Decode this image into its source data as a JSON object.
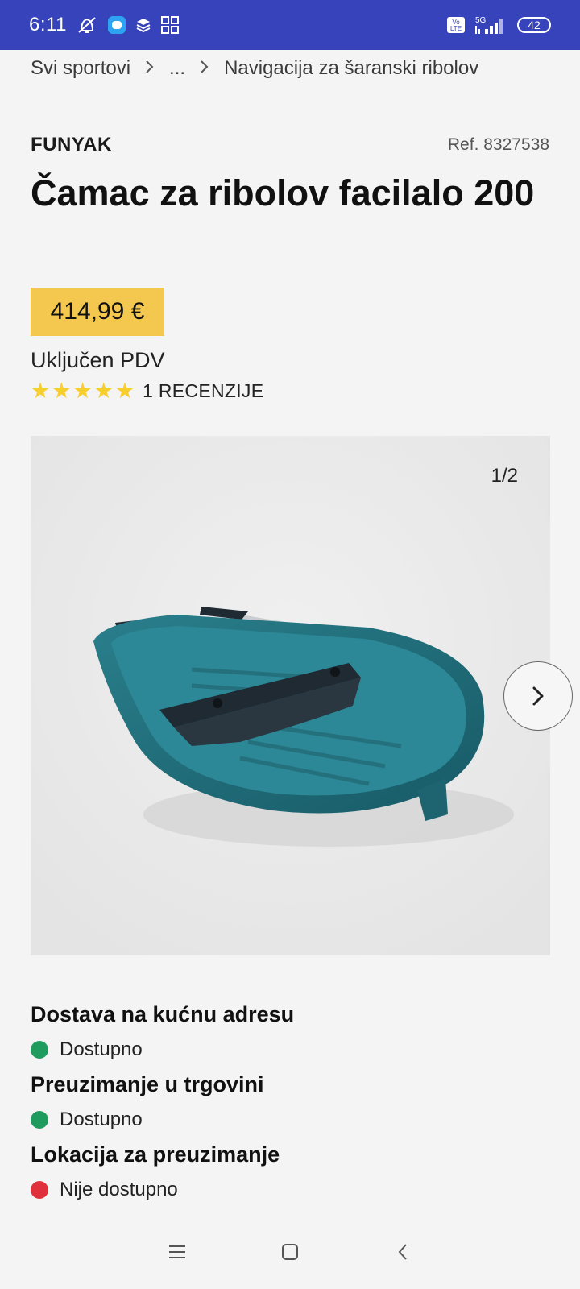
{
  "status_bar": {
    "time": "6:11",
    "network": "5G",
    "volte": "Vo LTE",
    "battery": "42"
  },
  "breadcrumb": {
    "items": [
      "Svi sportovi",
      "...",
      "Navigacija za šaranski ribolov"
    ]
  },
  "product": {
    "brand": "FUNYAK",
    "ref": "Ref. 8327538",
    "title": "Čamac za ribolov facilalo 200",
    "price": "414,99 €",
    "vat": "Uključen PDV",
    "rating_stars": 5,
    "reviews": "1 RECENZIJE"
  },
  "gallery": {
    "counter": "1/2"
  },
  "availability": [
    {
      "label": "Dostava na kućnu adresu",
      "status": "Dostupno",
      "color": "#1f9b5e"
    },
    {
      "label": "Preuzimanje u trgovini",
      "status": "Dostupno",
      "color": "#1f9b5e"
    },
    {
      "label": "Lokacija za preuzimanje",
      "status": "Nije dostupno",
      "color": "#e0303c"
    }
  ],
  "colors": {
    "status_bar": "#3643ba",
    "price_badge": "#f4c74e",
    "star": "#f6cf2e",
    "boat": "#1e6b78"
  }
}
